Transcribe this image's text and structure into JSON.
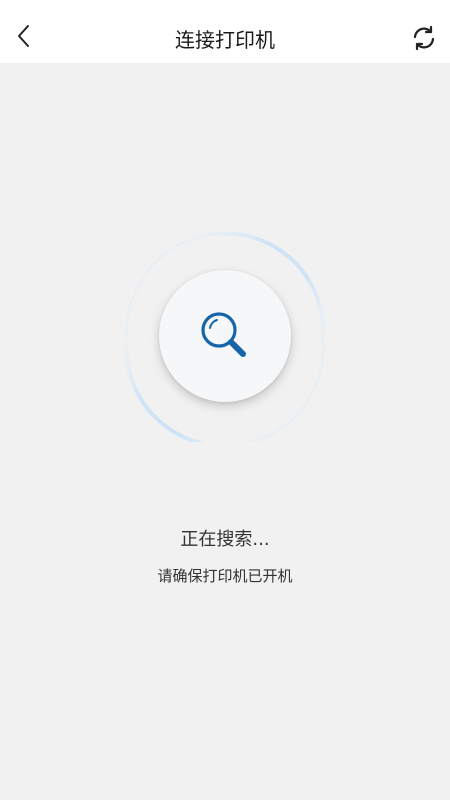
{
  "header": {
    "title": "连接打印机",
    "back_icon": "chevron-left-icon",
    "refresh_icon": "refresh-icon"
  },
  "search": {
    "icon": "magnifier-icon",
    "status_text": "正在搜索...",
    "hint_text": "请确保打印机已开机"
  },
  "colors": {
    "accent": "#1565a8",
    "ring": "#cfe3f7",
    "background": "#f1f1f1",
    "header_bg": "#ffffff"
  }
}
